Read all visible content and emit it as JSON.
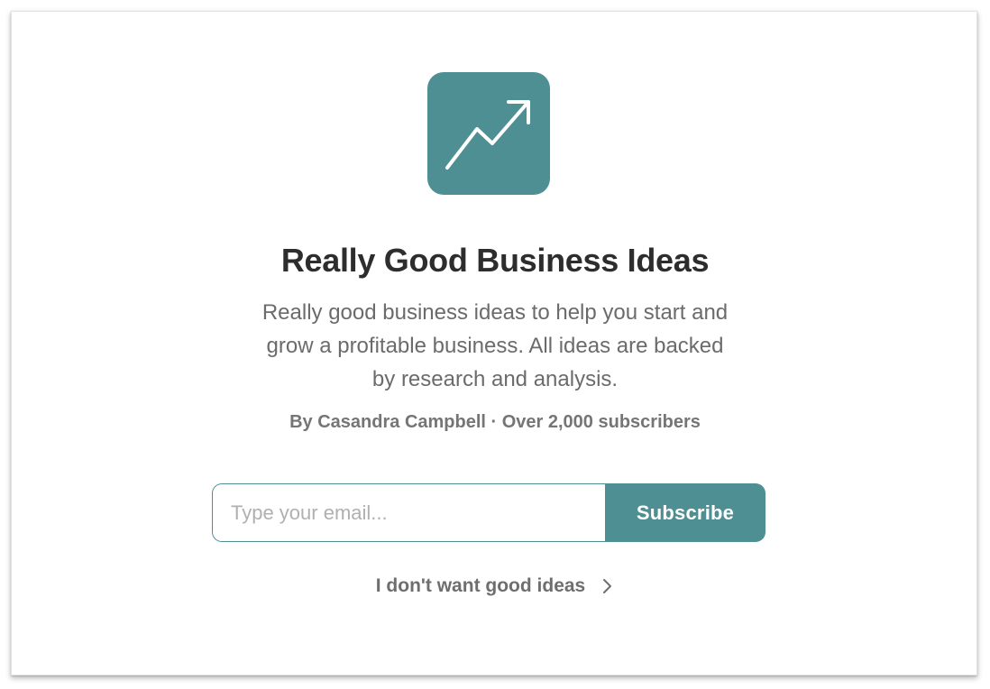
{
  "publication": {
    "title": "Really Good Business Ideas",
    "description": "Really good business ideas to help you start and grow a profitable business. All ideas are backed by research and analysis.",
    "byline": "By Casandra Campbell · Over 2,000 subscribers",
    "logo_icon": "trending-up-arrow-icon"
  },
  "signup": {
    "email_placeholder": "Type your email...",
    "email_value": "",
    "subscribe_label": "Subscribe"
  },
  "skip": {
    "label": "I don't want good ideas",
    "icon": "chevron-right-icon"
  },
  "colors": {
    "accent": "#4e8f93",
    "title": "#2d2d2d",
    "muted": "#6b6b6b"
  }
}
